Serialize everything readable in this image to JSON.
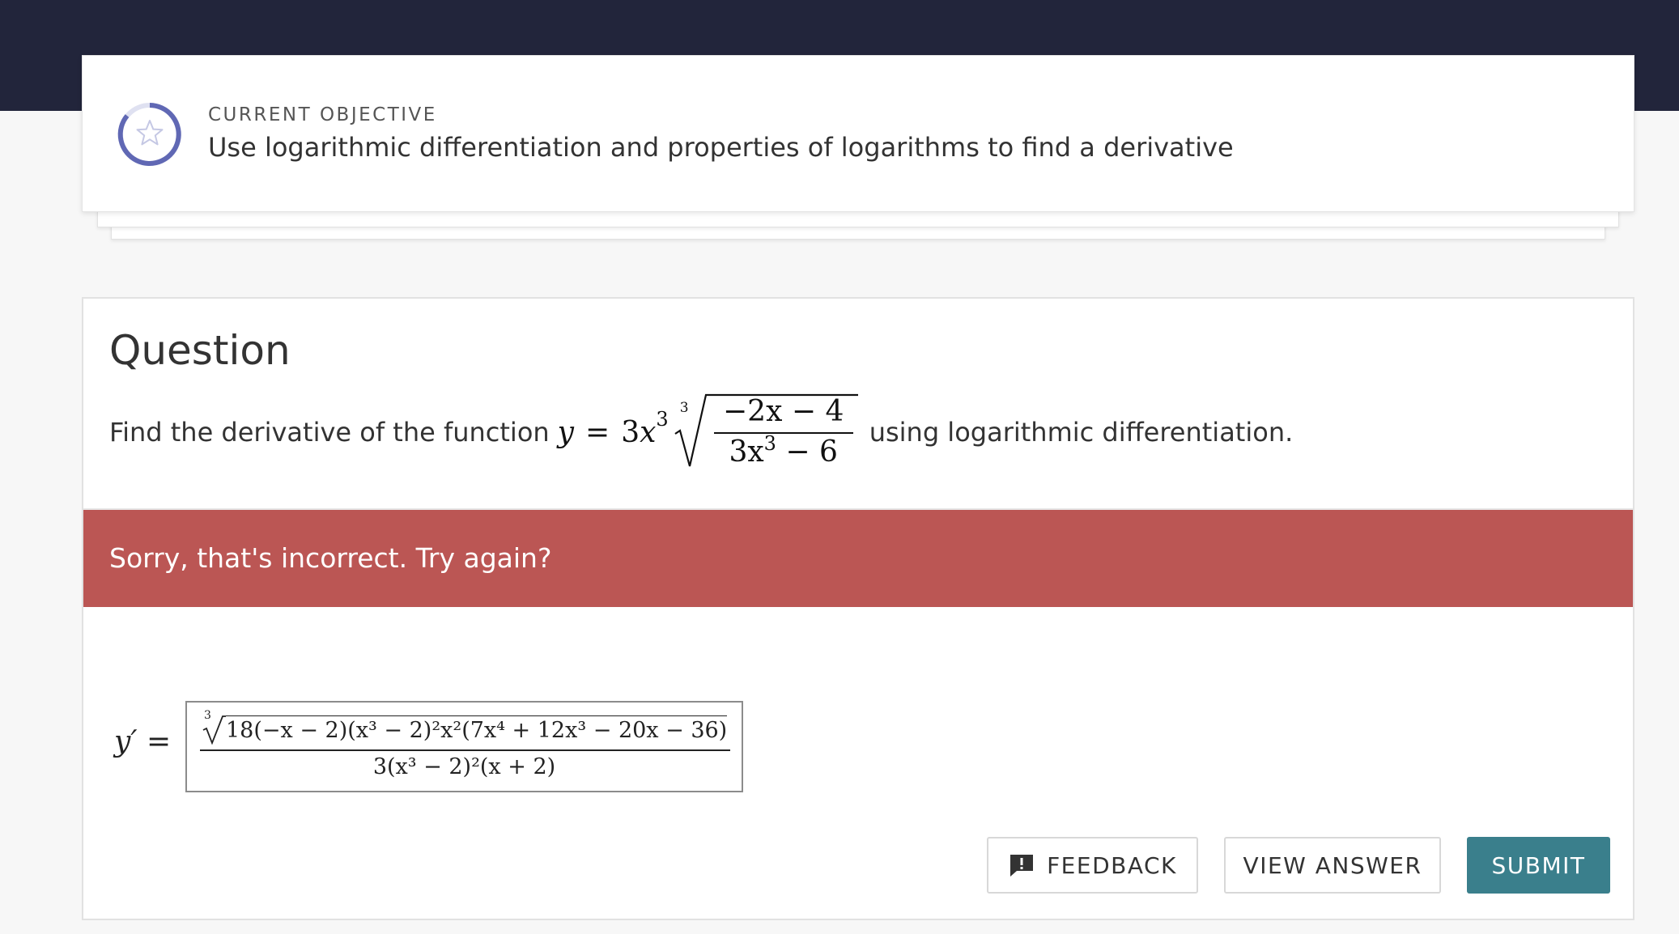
{
  "objective": {
    "eyebrow": "CURRENT OBJECTIVE",
    "text": "Use logarithmic differentiation and properties of logarithms to find a derivative",
    "icon": "star-icon",
    "ring_color": "#6068b4"
  },
  "question": {
    "title": "Question",
    "prompt_before": "Find the derivative of the function",
    "prompt_after": "using logarithmic differentiation.",
    "function": {
      "lhs": "y",
      "equals": "=",
      "coef": "3",
      "var": "x",
      "exp": "3",
      "root_index": "3",
      "num": "−2x − 4",
      "den_base": "3x",
      "den_exp": "3",
      "den_rest": " − 6"
    }
  },
  "feedback": {
    "message": "Sorry, that's incorrect. Try again?",
    "color": "#bb5654"
  },
  "answer": {
    "label": "y′ =",
    "root_index": "3",
    "numerator": "18(−x − 2)(x³ − 2)²x²(7x⁴ + 12x³ − 20x − 36)",
    "denominator": "3(x³ − 2)²(x + 2)"
  },
  "buttons": {
    "feedback": "FEEDBACK",
    "view_answer": "VIEW ANSWER",
    "submit": "SUBMIT",
    "submit_color": "#3a7f8c"
  }
}
